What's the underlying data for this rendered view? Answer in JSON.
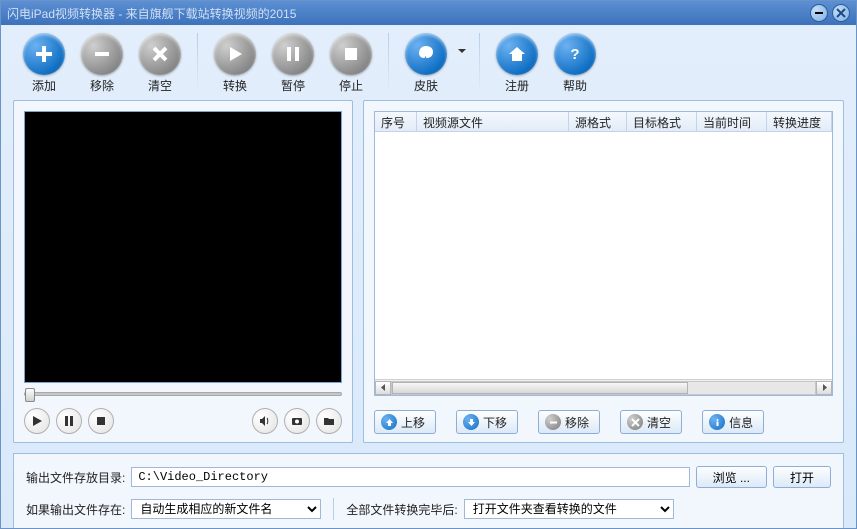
{
  "window": {
    "title": "闪电iPad视频转换器 - 来自旗舰下载站转换视频的2015"
  },
  "toolbar": {
    "add": "添加",
    "remove": "移除",
    "clear": "清空",
    "convert": "转换",
    "pause": "暂停",
    "stop": "停止",
    "skin": "皮肤",
    "register": "注册",
    "help": "帮助"
  },
  "table": {
    "cols": {
      "index": "序号",
      "source": "视频源文件",
      "srcfmt": "源格式",
      "dstfmt": "目标格式",
      "time": "当前时间",
      "progress": "转换进度"
    }
  },
  "listButtons": {
    "up": "上移",
    "down": "下移",
    "remove": "移除",
    "clear": "清空",
    "info": "信息"
  },
  "output": {
    "dirLabel": "输出文件存放目录:",
    "dirValue": "C:\\Video_Directory",
    "browse": "浏览 ...",
    "open": "打开",
    "existsLabel": "如果输出文件存在:",
    "existsValue": "自动生成相应的新文件名",
    "afterLabel": "全部文件转换完毕后:",
    "afterValue": "打开文件夹查看转换的文件"
  }
}
